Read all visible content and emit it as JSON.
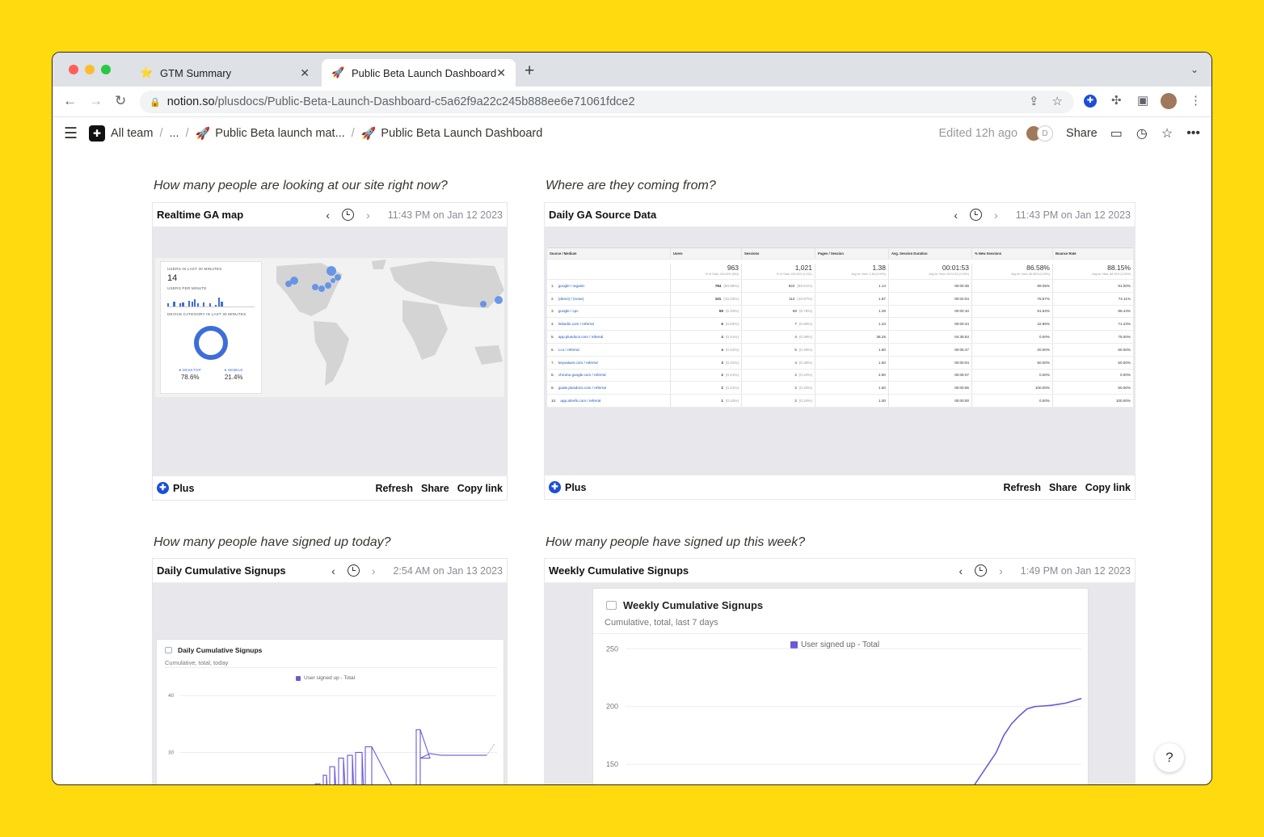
{
  "browser": {
    "tabs": [
      {
        "icon": "⭐",
        "title": "GTM Summary"
      },
      {
        "icon": "🚀",
        "title": "Public Beta Launch Dashboard"
      }
    ],
    "url_domain": "notion.so",
    "url_path": "/plusdocs/Public-Beta-Launch-Dashboard-c5a62f9a22c245b888ee6e71061fdce2"
  },
  "notion": {
    "breadcrumbs": [
      "All team",
      "...",
      "Public Beta launch mat...",
      "Public Beta Launch Dashboard"
    ],
    "edited": "Edited 12h ago",
    "avatar_letter": "D",
    "share": "Share"
  },
  "questions": {
    "q1": "How many people are looking at our site right now?",
    "q2": "Where are they coming from?",
    "q3": "How many people have signed up today?",
    "q4": "How many people have signed up this week?"
  },
  "footer": {
    "brand": "Plus",
    "refresh": "Refresh",
    "share": "Share",
    "copy": "Copy link"
  },
  "embeds": {
    "map": {
      "title": "Realtime GA map",
      "ts": "11:43 PM on Jan 12 2023"
    },
    "source": {
      "title": "Daily GA Source Data",
      "ts": "11:43 PM on Jan 12 2023"
    },
    "daily": {
      "title": "Daily Cumulative Signups",
      "ts": "2:54 AM on Jan 13 2023"
    },
    "weekly": {
      "title": "Weekly Cumulative Signups",
      "ts": "1:49 PM on Jan 12 2023"
    }
  },
  "ga_realtime": {
    "users_label": "USERS IN LAST 30 MINUTES",
    "users": "14",
    "per_minute_label": "USERS PER MINUTE",
    "device_label": "DEVICE CATEGORY IN LAST 30 MINUTES",
    "desktop_label": "● DESKTOP",
    "desktop": "78.6%",
    "mobile_label": "● MOBILE",
    "mobile": "21.4%",
    "device_share": {
      "desktop": 0.786,
      "mobile": 0.214
    },
    "brand_color": "#3d6ed8"
  },
  "ga_table": {
    "headers": [
      "Source / Medium",
      "Users",
      "Sessions",
      "Pages / Session",
      "Avg. Session Duration",
      "% New Sessions",
      "Bounce Rate"
    ],
    "totals": [
      {
        "v": "963",
        "s": "% of Total: 100.00% (963)"
      },
      {
        "v": "1,021",
        "s": "% of Total: 100.00% (1,021)"
      },
      {
        "v": "1.38",
        "s": "Avg for View: 1.38 (0.00%)"
      },
      {
        "v": "00:01:53",
        "s": "Avg for View: 00:01:53 (0.00%)"
      },
      {
        "v": "86.58%",
        "s": "Avg for View: 86.58% (0.00%)"
      },
      {
        "v": "88.15%",
        "s": "Avg for View: 88.15% (0.00%)"
      }
    ],
    "rows": [
      {
        "n": "1.",
        "src": "google / organic",
        "users": "784",
        "up": "(80.99%)",
        "sessions": "822",
        "sp": "(80.51%)",
        "pps": "1.14",
        "dur": "00:00:38",
        "new": "89.05%",
        "bounce": "91.00%"
      },
      {
        "n": "2.",
        "src": "(direct) / (none)",
        "users": "101",
        "up": "(10.43%)",
        "sessions": "112",
        "sp": "(10.97%)",
        "pps": "1.87",
        "dur": "00:02:04",
        "new": "78.57%",
        "bounce": "74.11%"
      },
      {
        "n": "3.",
        "src": "google / cpc",
        "users": "59",
        "up": "(6.10%)",
        "sessions": "59",
        "sp": "(5.78%)",
        "pps": "1.29",
        "dur": "00:00:10",
        "new": "91.53%",
        "bounce": "86.44%"
      },
      {
        "n": "4.",
        "src": "linkedin.com / referral",
        "users": "6",
        "up": "(0.62%)",
        "sessions": "7",
        "sp": "(0.69%)",
        "pps": "1.43",
        "dur": "00:00:44",
        "new": "42.86%",
        "bounce": "71.43%"
      },
      {
        "n": "5.",
        "src": "app.plusdocs.com / referral",
        "users": "4",
        "up": "(0.41%)",
        "sessions": "4",
        "sp": "(0.39%)",
        "pps": "38.25",
        "dur": "04:35:53",
        "new": "0.00%",
        "bounce": "75.00%"
      },
      {
        "n": "6.",
        "src": "t.co / referral",
        "users": "4",
        "up": "(0.41%)",
        "sessions": "5",
        "sp": "(0.49%)",
        "pps": "1.60",
        "dur": "00:05:47",
        "new": "20.00%",
        "bounce": "60.00%"
      },
      {
        "n": "7.",
        "src": "keyvalues.com / referral",
        "users": "3",
        "up": "(0.31%)",
        "sessions": "4",
        "sp": "(0.39%)",
        "pps": "1.50",
        "dur": "00:00:04",
        "new": "50.00%",
        "bounce": "50.00%"
      },
      {
        "n": "8.",
        "src": "chrome.google.com / referral",
        "users": "2",
        "up": "(0.21%)",
        "sessions": "2",
        "sp": "(0.20%)",
        "pps": "2.50",
        "dur": "00:06:07",
        "new": "0.00%",
        "bounce": "0.00%"
      },
      {
        "n": "9.",
        "src": "guide.plusdocs.com / referral",
        "users": "2",
        "up": "(0.21%)",
        "sessions": "2",
        "sp": "(0.20%)",
        "pps": "1.50",
        "dur": "00:00:06",
        "new": "100.00%",
        "bounce": "50.00%"
      },
      {
        "n": "10.",
        "src": "app.ahrefs.com / referral",
        "users": "1",
        "up": "(0.10%)",
        "sessions": "2",
        "sp": "(0.20%)",
        "pps": "1.00",
        "dur": "00:00:00",
        "new": "0.00%",
        "bounce": "100.00%"
      }
    ]
  },
  "daily_chart": {
    "title": "Daily Cumulative Signups",
    "subtitle": "Cumulative, total, today",
    "legend": "User signed up - Total"
  },
  "weekly_chart": {
    "title": "Weekly Cumulative Signups",
    "subtitle": "Cumulative, total, last 7 days",
    "legend": "User signed up - Total"
  },
  "chart_data": [
    {
      "type": "line",
      "title": "Daily Cumulative Signups",
      "subtitle": "Cumulative, total, today",
      "series": [
        {
          "name": "User signed up - Total",
          "color": "#6b5ad8"
        }
      ],
      "y_ticks": [
        40,
        30,
        20
      ],
      "ylim": [
        15,
        42
      ],
      "step_levels": [
        19,
        21,
        23,
        24.5,
        26,
        27.5,
        29,
        29.5,
        30,
        31,
        34
      ],
      "tail": [
        29,
        29.8,
        29.5,
        29.5,
        29.5,
        29.5
      ]
    },
    {
      "type": "line",
      "title": "Weekly Cumulative Signups",
      "subtitle": "Cumulative, total, last 7 days",
      "series": [
        {
          "name": "User signed up - Total",
          "color": "#6b5ad8"
        }
      ],
      "y_ticks": [
        250,
        200,
        150
      ],
      "ylim": [
        120,
        260
      ],
      "values": [
        127,
        130,
        140,
        150,
        160,
        175,
        185,
        192,
        198,
        200,
        200.5,
        201,
        202,
        203,
        205,
        207
      ]
    }
  ]
}
